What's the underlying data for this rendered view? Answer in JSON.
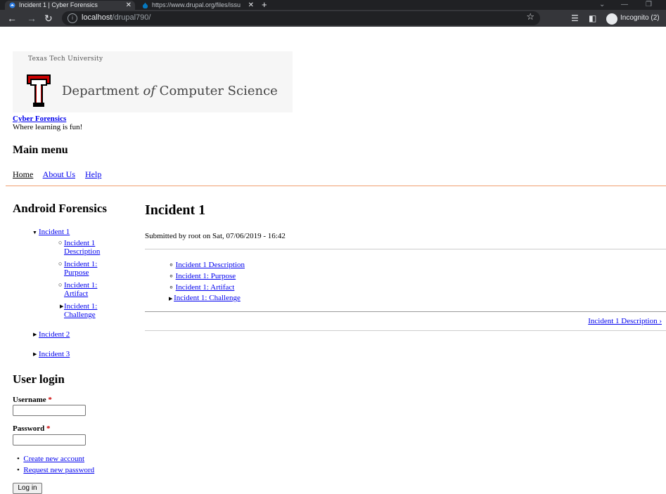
{
  "browser": {
    "tabs": [
      {
        "title": "Incident 1 | Cyber Forensics",
        "active": true
      },
      {
        "title": "https://www.drupal.org/files/issu",
        "active": false
      }
    ],
    "new_tab": "+",
    "window_controls": {
      "minimize": "—",
      "restore": "❐"
    },
    "address": {
      "host": "localhost",
      "path": "/drupal790/"
    },
    "profile_label": "Incognito (2)"
  },
  "header": {
    "logo": {
      "university": "Texas Tech University",
      "department_prefix": "Department ",
      "department_of": "of",
      "department_suffix": " Computer Science"
    },
    "site_name": "Cyber Forensics",
    "slogan": "Where learning is fun!",
    "menu_heading": "Main menu",
    "menu": [
      "Home",
      "About Us",
      "Help"
    ]
  },
  "sidebar": {
    "heading": "Android Forensics",
    "book": {
      "incident1": "Incident 1",
      "children": [
        [
          "Incident 1",
          "Description"
        ],
        [
          "Incident 1:",
          "Purpose"
        ],
        [
          "Incident 1:",
          "Artifact"
        ],
        [
          "Incident 1:",
          "Challenge"
        ]
      ],
      "incident2": "Incident 2",
      "incident3": "Incident 3"
    },
    "login": {
      "heading": "User login",
      "username_label": "Username",
      "password_label": "Password",
      "required_mark": "*",
      "create_account": "Create new account",
      "request_password": "Request new password",
      "submit": "Log in"
    }
  },
  "main": {
    "title": "Incident 1",
    "submitted": "Submitted by root on Sat, 07/06/2019 - 16:42",
    "links": [
      "Incident 1 Description",
      "Incident 1: Purpose",
      "Incident 1: Artifact",
      "Incident 1: Challenge"
    ],
    "next_link": "Incident 1 Description ›"
  }
}
